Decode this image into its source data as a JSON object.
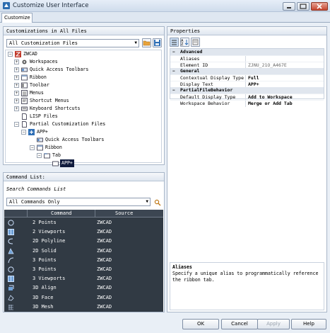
{
  "window": {
    "title": "Customize User Interface"
  },
  "tabs": [
    {
      "label": "Customize"
    }
  ],
  "customizations": {
    "header": "Customizations in All Files",
    "filter_value": "All Customization Files",
    "tree": [
      {
        "label": "ZWCAD"
      },
      {
        "label": "Workspaces"
      },
      {
        "label": "Quick Access Toolbars"
      },
      {
        "label": "Ribbon"
      },
      {
        "label": "Toolbar"
      },
      {
        "label": "Menus"
      },
      {
        "label": "Shortcut Menus"
      },
      {
        "label": "Keyboard Shortcuts"
      },
      {
        "label": "LISP Files"
      },
      {
        "label": "Partial Customization Files"
      },
      {
        "label": "APP+"
      },
      {
        "label": "Quick Access Toolbars"
      },
      {
        "label": "Ribbon"
      },
      {
        "label": "Tab"
      },
      {
        "label": "APP+"
      }
    ]
  },
  "command_list": {
    "header": "Command List:",
    "search_label": "Search Commands List",
    "filter_value": "All Commands Only",
    "col_command": "Command",
    "col_source": "Source",
    "rows": [
      {
        "name": "2 Points",
        "source": "ZWCAD",
        "icon": "circle-icon"
      },
      {
        "name": "2 Viewports",
        "source": "ZWCAD",
        "icon": "viewport-icon"
      },
      {
        "name": "2D Polyline",
        "source": "ZWCAD",
        "icon": "polyline-icon"
      },
      {
        "name": "2D Solid",
        "source": "ZWCAD",
        "icon": "solid-icon"
      },
      {
        "name": "3 Points",
        "source": "ZWCAD",
        "icon": "arc-icon"
      },
      {
        "name": "3 Points",
        "source": "ZWCAD",
        "icon": "circle-icon"
      },
      {
        "name": "3 Viewports",
        "source": "ZWCAD",
        "icon": "viewport-icon"
      },
      {
        "name": "3D Align",
        "source": "ZWCAD",
        "icon": "align-icon"
      },
      {
        "name": "3D Face",
        "source": "ZWCAD",
        "icon": "face-icon"
      },
      {
        "name": "3D Mesh",
        "source": "ZWCAD",
        "icon": "mesh-icon"
      }
    ]
  },
  "properties": {
    "header": "Properties",
    "categories": [
      {
        "name": "Advanced",
        "rows": [
          {
            "name": "Aliases",
            "value": ""
          },
          {
            "name": "Element ID",
            "value": "ZJNU_21O_A467E"
          }
        ]
      },
      {
        "name": "General",
        "rows": [
          {
            "name": "Contextual Display Type",
            "value": "Full"
          },
          {
            "name": "Display Text",
            "value": "APP+"
          }
        ]
      },
      {
        "name": "PartialFileBehavior",
        "rows": [
          {
            "name": "Default Display Type",
            "value": "Add to Workspace"
          },
          {
            "name": "Workspace Behavior",
            "value": "Merge or Add Tab"
          }
        ]
      }
    ],
    "description_title": "Aliases",
    "description_text": "Specify a unique alias to programmatically reference the ribbon tab."
  },
  "buttons": {
    "ok": "OK",
    "cancel": "Cancel",
    "apply": "Apply",
    "help": "Help"
  }
}
